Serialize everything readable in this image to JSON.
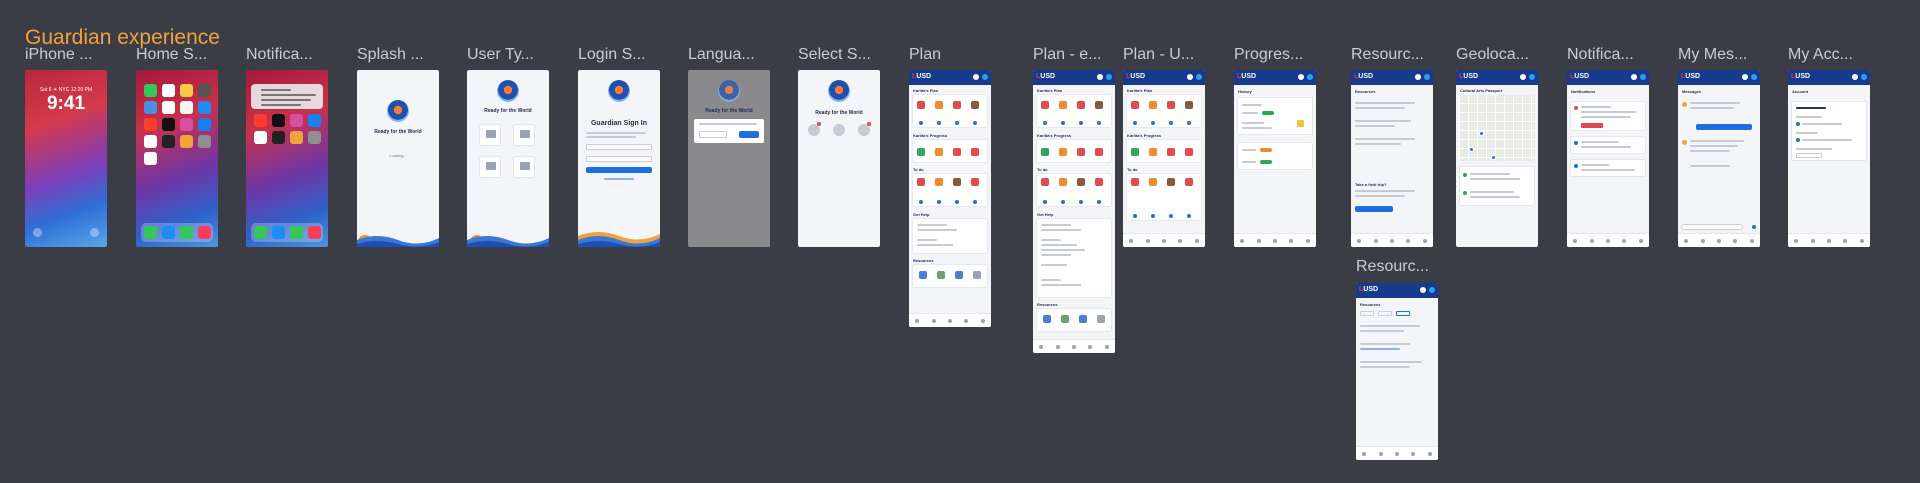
{
  "section_title": "Guardian experience",
  "frames": [
    {
      "label": "iPhone ..."
    },
    {
      "label": "Home S..."
    },
    {
      "label": "Notifica..."
    },
    {
      "label": "Splash ..."
    },
    {
      "label": "User Ty..."
    },
    {
      "label": "Login S..."
    },
    {
      "label": "Langua..."
    },
    {
      "label": "Select S..."
    },
    {
      "label": "Plan"
    },
    {
      "label": "Plan - e..."
    },
    {
      "label": "Plan - U..."
    },
    {
      "label": "Progres..."
    },
    {
      "label": "Resourc..."
    },
    {
      "label": "Geoloca..."
    },
    {
      "label": "Notifica..."
    },
    {
      "label": "My Mes..."
    },
    {
      "label": "My Acc..."
    },
    {
      "label": "Resourc..."
    }
  ],
  "lock": {
    "date": "Sat 6 ☀ NYC 12:20 PM",
    "time": "9:41"
  },
  "screens": {
    "ready": "Ready for the World",
    "signin": "Guardian Sign In",
    "brand": "USD",
    "brand_mark": "L",
    "plan_title": "Karlita's Plan",
    "progress_title": "Karlita's Progress",
    "todo": "To do",
    "get_help": "Get Help",
    "resources": "Resources",
    "history": "History",
    "passport": "Cultural Arts Passport",
    "notifications": "Notifications",
    "messages": "Messages",
    "account": "Account",
    "field_trip": "Take a field trip?",
    "loading": "Loading..."
  },
  "colors": {
    "accent": "#f0a33a",
    "header": "#173a8c",
    "primary": "#1f6fe0"
  }
}
